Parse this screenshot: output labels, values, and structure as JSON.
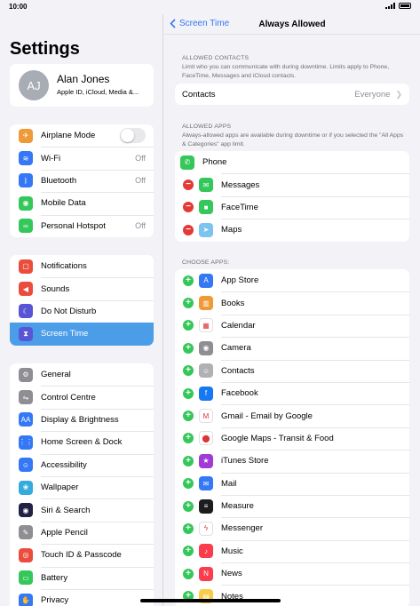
{
  "status": {
    "time": "10:00"
  },
  "left": {
    "title": "Settings",
    "profile": {
      "initials": "AJ",
      "name": "Alan Jones",
      "sub": "Apple ID, iCloud, Media &..."
    },
    "group1": [
      {
        "label": "Airplane Mode",
        "icon": "airplane-icon",
        "color": "#f09a37",
        "glyph": "✈",
        "toggle": true
      },
      {
        "label": "Wi-Fi",
        "icon": "wifi-icon",
        "color": "#3478f6",
        "glyph": "≋",
        "value": "Off"
      },
      {
        "label": "Bluetooth",
        "icon": "bluetooth-icon",
        "color": "#3478f6",
        "glyph": "ᛒ",
        "value": "Off"
      },
      {
        "label": "Mobile Data",
        "icon": "antenna-icon",
        "color": "#34c759",
        "glyph": "◉"
      },
      {
        "label": "Personal Hotspot",
        "icon": "hotspot-icon",
        "color": "#34c759",
        "glyph": "∞",
        "value": "Off"
      }
    ],
    "group2": [
      {
        "label": "Notifications",
        "icon": "notifications-icon",
        "color": "#eb4d3d",
        "glyph": "▢"
      },
      {
        "label": "Sounds",
        "icon": "speaker-icon",
        "color": "#eb4d3d",
        "glyph": "◀"
      },
      {
        "label": "Do Not Disturb",
        "icon": "moon-icon",
        "color": "#5856d6",
        "glyph": "☾"
      },
      {
        "label": "Screen Time",
        "icon": "hourglass-icon",
        "color": "#5856d6",
        "glyph": "⧗",
        "selected": true
      }
    ],
    "group3": [
      {
        "label": "General",
        "icon": "gear-icon",
        "color": "#8e8e93",
        "glyph": "⚙"
      },
      {
        "label": "Control Centre",
        "icon": "switches-icon",
        "color": "#8e8e93",
        "glyph": "⇋"
      },
      {
        "label": "Display & Brightness",
        "icon": "text-size-icon",
        "color": "#3478f6",
        "glyph": "AA"
      },
      {
        "label": "Home Screen & Dock",
        "icon": "grid-icon",
        "color": "#3478f6",
        "glyph": "⋮⋮"
      },
      {
        "label": "Accessibility",
        "icon": "accessibility-icon",
        "color": "#3478f6",
        "glyph": "☺"
      },
      {
        "label": "Wallpaper",
        "icon": "flower-icon",
        "color": "#35aadc",
        "glyph": "❀"
      },
      {
        "label": "Siri & Search",
        "icon": "siri-icon",
        "color": "#222244",
        "glyph": "◉"
      },
      {
        "label": "Apple Pencil",
        "icon": "pencil-icon",
        "color": "#8e8e93",
        "glyph": "✎"
      },
      {
        "label": "Touch ID & Passcode",
        "icon": "fingerprint-icon",
        "color": "#eb4d3d",
        "glyph": "◎"
      },
      {
        "label": "Battery",
        "icon": "battery-icon",
        "color": "#34c759",
        "glyph": "▭"
      },
      {
        "label": "Privacy",
        "icon": "hand-icon",
        "color": "#3478f6",
        "glyph": "✋"
      }
    ]
  },
  "right": {
    "back_label": "Screen Time",
    "title": "Always Allowed",
    "contacts_header": "ALLOWED CONTACTS",
    "contacts_note": "Limit who you can communicate with during downtime. Limits apply to Phone, FaceTime, Messages and iCloud contacts.",
    "contacts_row": {
      "label": "Contacts",
      "value": "Everyone"
    },
    "apps_header": "ALLOWED APPS",
    "apps_note": "Always-allowed apps are available during downtime or if you selected the \"All Apps & Categories\" app limit.",
    "allowed_apps": [
      {
        "label": "Phone",
        "icon": "phone-icon",
        "color": "#34c759",
        "glyph": "✆",
        "removable": false
      },
      {
        "label": "Messages",
        "icon": "messages-icon",
        "color": "#34c759",
        "glyph": "✉",
        "removable": true
      },
      {
        "label": "FaceTime",
        "icon": "facetime-icon",
        "color": "#34c759",
        "glyph": "■",
        "removable": true
      },
      {
        "label": "Maps",
        "icon": "maps-icon",
        "color": "#7cc4f0",
        "glyph": "➤",
        "removable": true
      }
    ],
    "choose_header": "CHOOSE APPS:",
    "choose_apps": [
      {
        "label": "App Store",
        "icon": "app-store-icon",
        "color": "#3478f6",
        "glyph": "A"
      },
      {
        "label": "Books",
        "icon": "books-icon",
        "color": "#f09a37",
        "glyph": "▥"
      },
      {
        "label": "Calendar",
        "icon": "calendar-icon",
        "color": "#ffffff",
        "glyph": "▦"
      },
      {
        "label": "Camera",
        "icon": "camera-icon",
        "color": "#8e8e93",
        "glyph": "◉"
      },
      {
        "label": "Contacts",
        "icon": "contacts-icon",
        "color": "#b0b0b5",
        "glyph": "☺"
      },
      {
        "label": "Facebook",
        "icon": "facebook-icon",
        "color": "#1877f2",
        "glyph": "f"
      },
      {
        "label": "Gmail - Email by Google",
        "icon": "gmail-icon",
        "color": "#ffffff",
        "glyph": "M"
      },
      {
        "label": "Google Maps - Transit & Food",
        "icon": "google-maps-icon",
        "color": "#ffffff",
        "glyph": "⬤"
      },
      {
        "label": "iTunes Store",
        "icon": "itunes-store-icon",
        "color": "#a23bd6",
        "glyph": "★"
      },
      {
        "label": "Mail",
        "icon": "mail-icon",
        "color": "#3478f6",
        "glyph": "✉"
      },
      {
        "label": "Measure",
        "icon": "measure-icon",
        "color": "#1c1c1e",
        "glyph": "≡"
      },
      {
        "label": "Messenger",
        "icon": "messenger-icon",
        "color": "#ffffff",
        "glyph": "ϟ"
      },
      {
        "label": "Music",
        "icon": "music-icon",
        "color": "#fa3c4c",
        "glyph": "♪"
      },
      {
        "label": "News",
        "icon": "news-icon",
        "color": "#fa3c4c",
        "glyph": "N"
      },
      {
        "label": "Notes",
        "icon": "notes-icon",
        "color": "#f7cd46",
        "glyph": "▤"
      }
    ]
  }
}
